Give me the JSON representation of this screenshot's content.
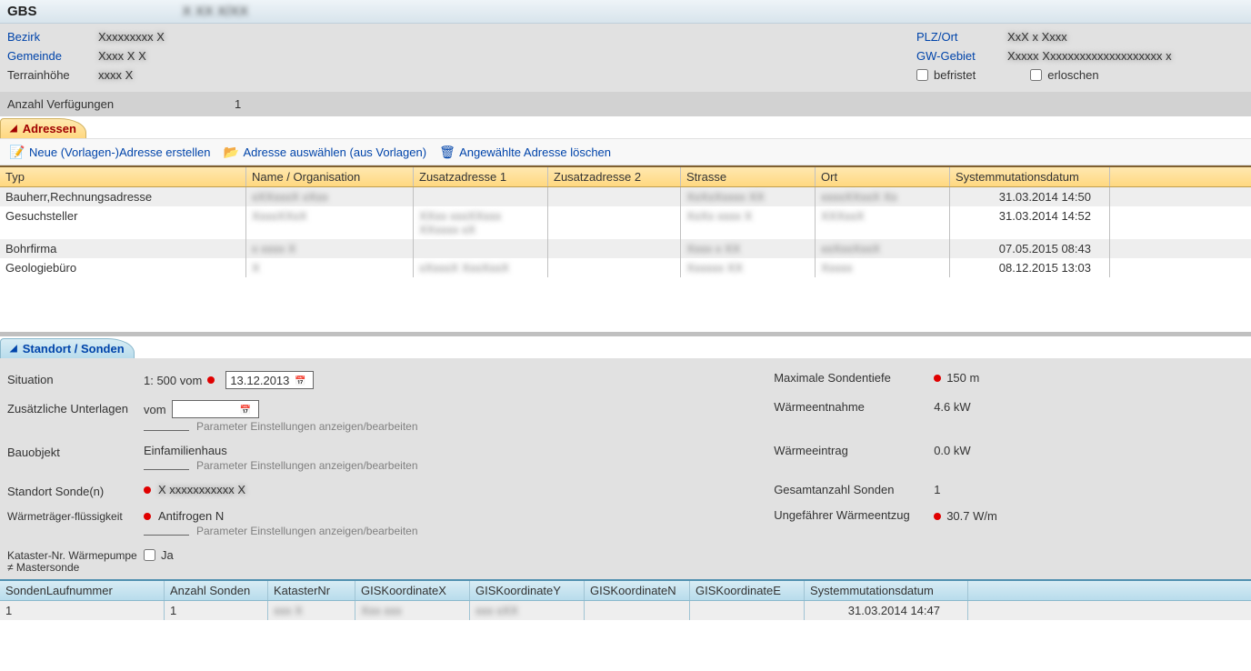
{
  "title": {
    "app": "GBS",
    "ref": "X XX X/XX"
  },
  "info": {
    "bezirk_label": "Bezirk",
    "bezirk_value": "Xxxxxxxxx X",
    "gemeinde_label": "Gemeinde",
    "gemeinde_value": "Xxxx X X",
    "terrain_label": "Terrainhöhe",
    "terrain_value": "xxxx X",
    "plzort_label": "PLZ/Ort",
    "plzort_value": "XxX x Xxxx",
    "gwgebiet_label": "GW-Gebiet",
    "gwgebiet_value": "Xxxxx Xxxxxxxxxxxxxxxxxxxx x",
    "befristet_label": "befristet",
    "erloschen_label": "erloschen",
    "anzahl_label": "Anzahl Verfügungen",
    "anzahl_value": "1"
  },
  "sections": {
    "adressen": "Adressen",
    "standort": "Standort / Sonden"
  },
  "toolbar": {
    "new_addr": "Neue (Vorlagen-)Adresse erstellen",
    "choose_addr": "Adresse auswählen (aus Vorlagen)",
    "delete_addr": "Angewählte Adresse löschen"
  },
  "addr_headers": {
    "typ": "Typ",
    "name": "Name / Organisation",
    "z1": "Zusatzadresse 1",
    "z2": "Zusatzadresse 2",
    "strasse": "Strasse",
    "ort": "Ort",
    "mutdatum": "Systemmutationsdatum"
  },
  "addresses": [
    {
      "typ": "Bauherr,Rechnungsadresse",
      "name": "xXXxxxX xXxx",
      "z1": "",
      "z2": "",
      "strasse": "XxXxXxxxx XX",
      "ort": "xxxxXXxxX Xx",
      "mut": "31.03.2014 14:50"
    },
    {
      "typ": "Gesuchsteller",
      "name": "XxxxXXxX",
      "z1": "XXxx xxxXXxxx XXxxxx xX",
      "z2": "",
      "strasse": "XxXx xxxx X",
      "ort": "XXXxxX",
      "mut": "31.03.2014 14:52"
    },
    {
      "typ": "Bohrfirma",
      "name": "x xxxx X",
      "z1": "",
      "z2": "",
      "strasse": "Xxxx x XX",
      "ort": "xxXxxXxxX",
      "mut": "07.05.2015 08:43"
    },
    {
      "typ": "Geologiebüro",
      "name": "X",
      "z1": "xXxxxX XxxXxxX",
      "z2": "",
      "strasse": "Xxxxxx XX",
      "ort": "Xxxxx",
      "mut": "08.12.2015 13:03"
    }
  ],
  "standort": {
    "situation_label": "Situation",
    "situation_prefix": "1: 500 vom",
    "situation_date": "13.12.2013",
    "max_sondentiefe_label": "Maximale Sondentiefe",
    "max_sondentiefe_value": "150 m",
    "zusatz_label": "Zusätzliche Unterlagen",
    "zusatz_vom": "vom",
    "param_link": "Parameter Einstellungen anzeigen/bearbeiten",
    "waermeentnahme_label": "Wärmeentnahme",
    "waermeentnahme_value": "4.6 kW",
    "bauobjekt_label": "Bauobjekt",
    "bauobjekt_value": "Einfamilienhaus",
    "waermeeintrag_label": "Wärmeeintrag",
    "waermeeintrag_value": "0.0 kW",
    "standort_sonden_label": "Standort Sonde(n)",
    "standort_sonden_value": "X xxxxxxxxxxx X",
    "gesamtanzahl_label": "Gesamtanzahl Sonden",
    "gesamtanzahl_value": "1",
    "traeger_label": "Wärmeträger-flüssigkeit",
    "traeger_value": "Antifrogen N",
    "waermeentzug_label": "Ungefährer Wärmeentzug",
    "waermeentzug_value": "30.7 W/m",
    "kataster_label": "Kataster-Nr. Wärmepumpe ≠ Mastersonde",
    "kataster_ja": "Ja"
  },
  "sonden_headers": {
    "lauf": "SondenLaufnummer",
    "anzahl": "Anzahl Sonden",
    "katnr": "KatasterNr",
    "gx": "GISKoordinateX",
    "gy": "GISKoordinateY",
    "gn": "GISKoordinateN",
    "ge": "GISKoordinateE",
    "mut": "Systemmutationsdatum"
  },
  "sonden_rows": [
    {
      "lauf": "1",
      "anzahl": "1",
      "katnr": "xxx X",
      "gx": "Xxx xxx",
      "gy": "xxx xXX",
      "gn": "",
      "ge": "",
      "mut": "31.03.2014 14:47"
    }
  ]
}
